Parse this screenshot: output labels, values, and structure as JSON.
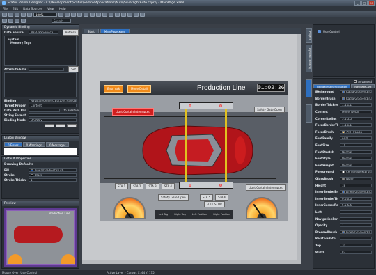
{
  "window": {
    "title": "Status Vision Designer - C:\\Development\\Status\\SampleApplications\\Auto\\SilverlightAuto.csproj - MainPage.xaml",
    "controls": [
      "_",
      "□",
      "×"
    ]
  },
  "menu": [
    "File",
    "Edit",
    "Data Sources",
    "View",
    "Help"
  ],
  "toolbar": {
    "zoom": "100%",
    "search_label": "Search"
  },
  "left": {
    "dynamic_binding": {
      "header": "Dynamic Binding",
      "data_source_label": "Data Source",
      "data_source_value": "NavGateService",
      "refresh_label": "Refresh",
      "tree": [
        "System",
        "Memory Tags"
      ],
      "attribute_filter_label": "Attribute Filter",
      "attribute_filter_button": "Set",
      "binding_label": "Binding",
      "binding_value": "NavigateGeneric.Buttons.NavigateLowerr",
      "target_property_label": "Target Property",
      "target_property_value": "Content",
      "data_path_label": "Data Path Part",
      "to_relative_label": "to Relative",
      "string_format_label": "String Format",
      "binding_mode_label": "Binding Mode",
      "binding_mode_value": "OneWay"
    },
    "dialog_window": {
      "header": "Dialog Window",
      "tabs": [
        "0 Errors",
        "0 Warnings",
        "0 Messages"
      ]
    },
    "default_properties": {
      "header": "Default Properties",
      "section": "Drawing Defaults",
      "rows": [
        {
          "label": "Fill",
          "value": "LinearGradientBrush",
          "color": "#2255aa"
        },
        {
          "label": "Stroke",
          "value": "Black",
          "color": "#000000"
        },
        {
          "label": "Stroke Thickness",
          "value": "1"
        }
      ]
    },
    "preview": {
      "header": "Preview",
      "title": "Production Line"
    }
  },
  "designer": {
    "tabs": [
      "Start",
      "MainPage.xaml"
    ],
    "screen": {
      "title": "Production Line",
      "clock": "01:02:36",
      "buttons": [
        "Error Ack",
        "Mode Detail"
      ],
      "light_curtain_top": "Light Curtain Interrupted",
      "safety_gate_top": "Safety Gate Open",
      "light_curtain_bottom": "Light Curtain Interrupted",
      "safety_gate_bottom": "Safety Gate Open",
      "full_stop": "FULL STOP",
      "station_labels": [
        "STA 1",
        "STA 2",
        "STA 3",
        "STA 4",
        "STA 5",
        "STA 6"
      ],
      "gauge_labels": [
        "Left Tag",
        "Right Tag",
        "Left Position",
        "Right Position"
      ]
    }
  },
  "right": {
    "user_control": "UserControl",
    "vertical_tabs": [
      "Project",
      "Dynamic Binding"
    ],
    "properties": {
      "advanced_label": "Advanced",
      "tabs": [
        "NavigateGeneric.Button Name",
        "NavigateCust"
      ],
      "rows": [
        {
          "label": "Background",
          "value": "RadialGradientBru",
          "color": "#3b72c8"
        },
        {
          "label": "BorderBrush",
          "value": "RadialGradientBru",
          "color": "#3b72c8"
        },
        {
          "label": "BorderThickness",
          "value": "1,1,1,1"
        },
        {
          "label": "Content",
          "value": "Model Detail"
        },
        {
          "label": "CornerRadius",
          "value": "5,5,5,5"
        },
        {
          "label": "FocusBorderThi",
          "value": "1,1,1,1"
        },
        {
          "label": "FocusBrush",
          "value": "#FFFFCC66",
          "color": "#ffcc66"
        },
        {
          "label": "FontFamily",
          "value": "Arial"
        },
        {
          "label": "FontSize",
          "value": "11"
        },
        {
          "label": "FontStretch",
          "value": "Normal"
        },
        {
          "label": "FontStyle",
          "value": "Normal"
        },
        {
          "label": "FontWeight",
          "value": "Normal"
        },
        {
          "label": "Foreground",
          "value": "CenteredTextBrush",
          "color": "#ffffff"
        },
        {
          "label": "GlassBrush",
          "value": "None",
          "color": "#888888"
        },
        {
          "label": "Height",
          "value": "18"
        },
        {
          "label": "InnerBorderBr",
          "value": "LinearGradientBru",
          "color": "#3b72c8"
        },
        {
          "label": "InnerBorderTh",
          "value": "0,0,0,0"
        },
        {
          "label": "InnerCornerRad",
          "value": "5,5,5,5"
        },
        {
          "label": "Left",
          "value": ""
        },
        {
          "label": "NavigationPart",
          "value": ""
        },
        {
          "label": "Opacity",
          "value": "1"
        },
        {
          "label": "PressedBrush",
          "value": "LinearGradientBru",
          "color": "#3b72c8"
        },
        {
          "label": "RelativePath",
          "value": ""
        },
        {
          "label": "Top",
          "value": "10"
        },
        {
          "label": "Width",
          "value": "87"
        }
      ]
    }
  },
  "status": {
    "left": "Mouse Over: UserControl",
    "middle": "Active Layer - Canvas  X: 44  Y: 175"
  }
}
